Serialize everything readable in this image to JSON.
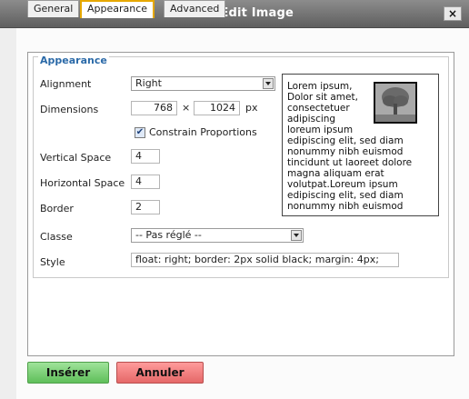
{
  "window": {
    "title": "Insert/Edit Image",
    "close_label": "×"
  },
  "tabs": [
    {
      "label": "General"
    },
    {
      "label": "Appearance"
    },
    {
      "label": "Advanced"
    }
  ],
  "appearance": {
    "legend": "Appearance",
    "alignment": {
      "label": "Alignment",
      "value": "Right"
    },
    "dimensions": {
      "label": "Dimensions",
      "width": "768",
      "sep": "×",
      "height": "1024",
      "unit": "px"
    },
    "constrain": {
      "label": "Constrain Proportions",
      "checked": true
    },
    "vspace": {
      "label": "Vertical Space",
      "value": "4"
    },
    "hspace": {
      "label": "Horizontal Space",
      "value": "4"
    },
    "border": {
      "label": "Border",
      "value": "2"
    },
    "classe": {
      "label": "Classe",
      "value": "-- Pas réglé --"
    },
    "style": {
      "label": "Style",
      "value": "float: right; border: 2px solid black; margin: 4px;"
    },
    "preview_text": "Lorem ipsum,\nDolor sit amet,\nconsectetuer\nadipiscing\nloreum ipsum\nedipiscing elit, sed diam\nnonummy nibh euismod\ntincidunt ut laoreet dolore\nmagna aliquam erat\nvolutpat.Loreum ipsum\nedipiscing elit, sed diam\nnonummy nibh euismod"
  },
  "buttons": {
    "insert": "Insérer",
    "cancel": "Annuler"
  },
  "icons": {
    "close": "close-icon",
    "preview_image": "tree-image-icon",
    "dropdown": "chevron-down-icon"
  }
}
